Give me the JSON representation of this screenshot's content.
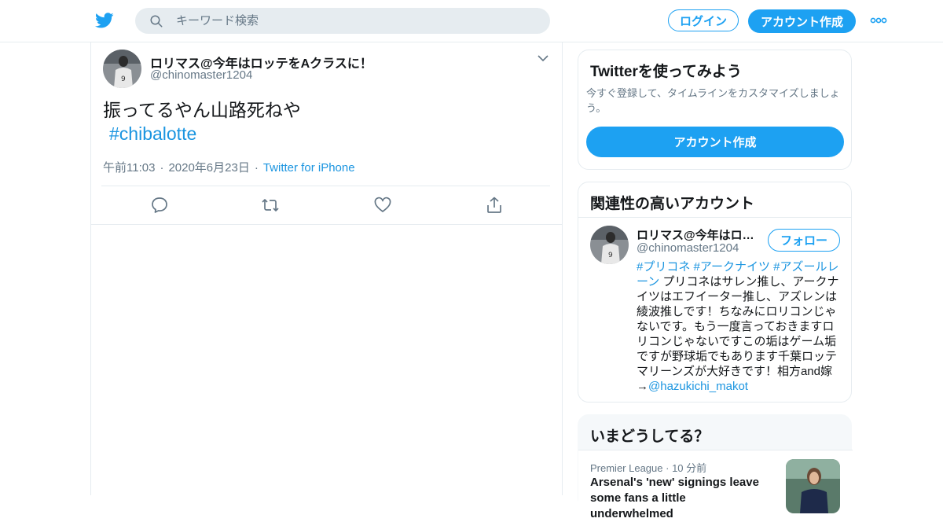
{
  "header": {
    "search_placeholder": "キーワード検索",
    "login_label": "ログイン",
    "signup_label": "アカウント作成"
  },
  "tweet": {
    "display_name": "ロリマス@今年はロッテをAクラスに！",
    "handle": "@chinomaster1204",
    "text": "振ってるやん山路死ねや",
    "hashtag": "#chibalotte",
    "time": "午前11:03",
    "date": "2020年6月23日",
    "source": "Twitter for iPhone"
  },
  "signup_card": {
    "title": "Twitterを使ってみよう",
    "description": "今すぐ登録して、タイムラインをカスタマイズしましょう。",
    "button_label": "アカウント作成"
  },
  "related": {
    "title": "関連性の高いアカウント",
    "account": {
      "name": "ロリマス@今年はロ…",
      "handle": "@chinomaster1204",
      "follow_label": "フォロー",
      "bio_hashtags": "#プリコネ #アークナイツ #アズールレーン",
      "bio_text": " プリコネはサレン推し、アークナイツはエフイーター推し、アズレンは綾波推しです！ちなみにロリコンじゃないです。もう一度言っておきますロリコンじゃないですこの垢はゲーム垢ですが野球垢でもあります千葉ロッテマリーンズが大好きです！相方and嫁→",
      "bio_mention": "@hazukichi_makot"
    }
  },
  "trends": {
    "title": "いまどうしてる？",
    "item": {
      "category": "Premier League",
      "time": "10 分前",
      "headline": "Arsenal's 'new' signings leave some fans a little underwhelmed"
    }
  },
  "colors": {
    "accent": "#1da1f2",
    "link": "#1b95e0",
    "secondary_text": "#657786",
    "border": "#e6ecf0"
  },
  "icons": {
    "logo": "twitter-bird-icon",
    "search": "search-icon",
    "more": "more-dots-icon",
    "caret": "chevron-down-icon",
    "reply": "reply-icon",
    "retweet": "retweet-icon",
    "like": "heart-icon",
    "share": "share-icon"
  }
}
